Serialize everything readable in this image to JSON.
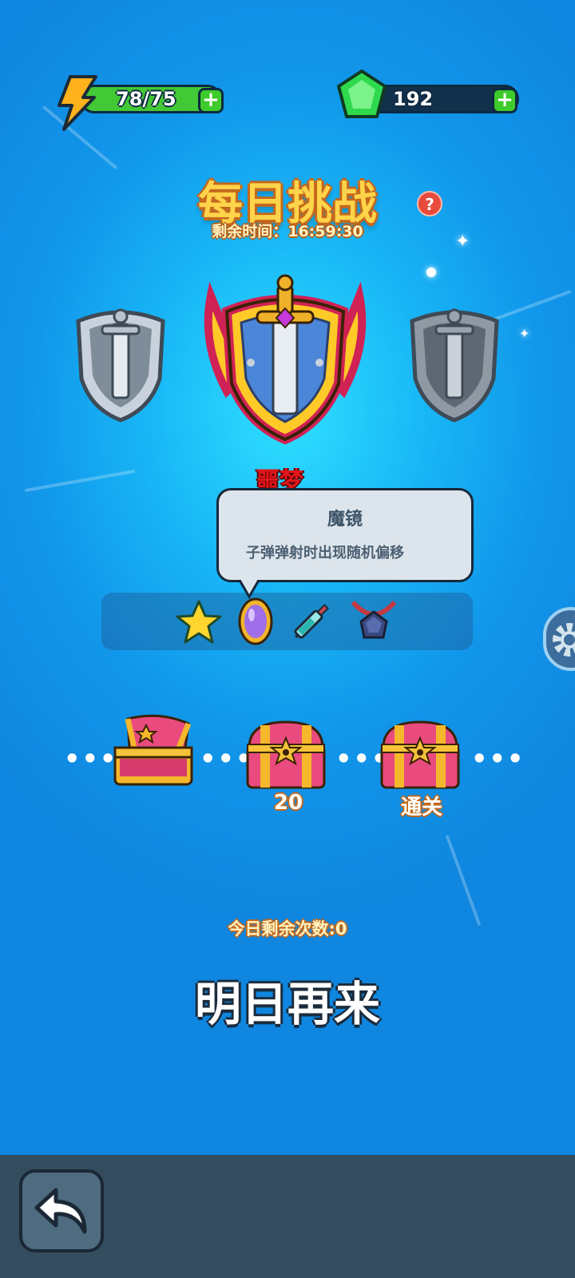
{
  "resources": {
    "energy": {
      "value": "78/75",
      "icon": "lightning-icon",
      "color": "#43c836"
    },
    "gems": {
      "value": "192",
      "icon": "green-gem-icon",
      "color": "#12304b"
    }
  },
  "challenge": {
    "title": "每日挑战",
    "timer": "剩余时间：16:59:30",
    "difficulty_label": "噩梦"
  },
  "tooltip": {
    "title": "魔镜",
    "description": "子弹弹射时出现随机偏移"
  },
  "modifiers": [
    {
      "icon": "star-icon"
    },
    {
      "icon": "magic-mirror-icon"
    },
    {
      "icon": "syringe-icon"
    },
    {
      "icon": "amulet-icon"
    }
  ],
  "chests": [
    {
      "label": "",
      "state": "opened"
    },
    {
      "label": "20",
      "state": "closed"
    },
    {
      "label": "通关",
      "state": "closed"
    }
  ],
  "remaining": "今日剩余次数:0",
  "come_back": "明日再来"
}
